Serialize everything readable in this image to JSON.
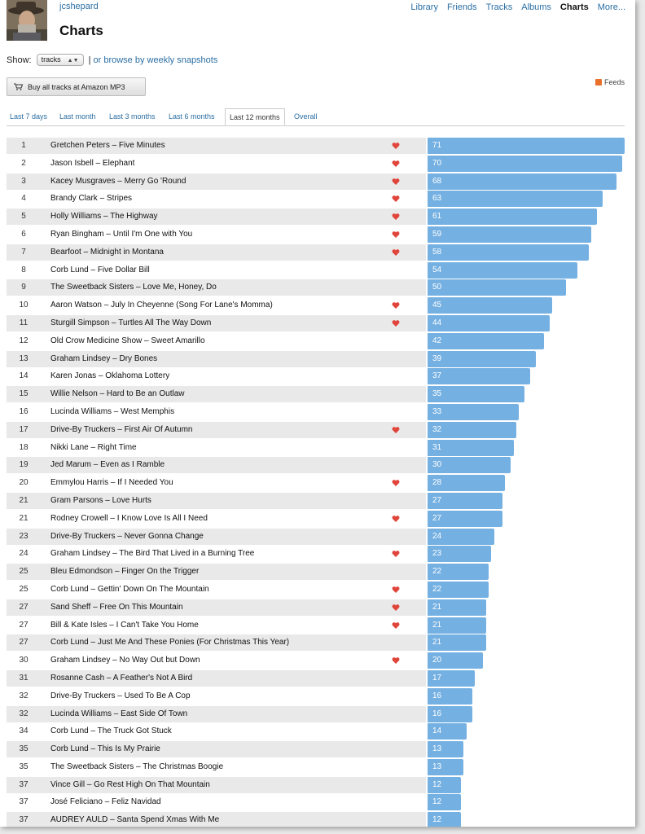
{
  "header": {
    "username": "jcshepard",
    "title": "Charts",
    "nav": [
      "Library",
      "Friends",
      "Tracks",
      "Albums",
      "Charts",
      "More..."
    ],
    "active_nav": "Charts"
  },
  "controls": {
    "show_label": "Show:",
    "show_value": "tracks",
    "separator": "|",
    "browse_link": "or browse by weekly snapshots",
    "buy_button": "Buy all tracks at Amazon MP3",
    "feeds": "Feeds"
  },
  "tabs": [
    "Last 7 days",
    "Last month",
    "Last 3 months",
    "Last 6 months",
    "Last 12 months",
    "Overall"
  ],
  "active_tab": "Last 12 months",
  "colors": {
    "bar": "#74b0e2",
    "link": "#2a6ea3",
    "heart": "#e0443a",
    "row_stripe": "#e9e9e9"
  },
  "chart_data": {
    "type": "bar",
    "rows": [
      {
        "rank": "1",
        "track": "Gretchen Peters – Five Minutes",
        "loved": true,
        "plays": 71
      },
      {
        "rank": "2",
        "track": "Jason Isbell – Elephant",
        "loved": true,
        "plays": 70
      },
      {
        "rank": "3",
        "track": "Kacey Musgraves – Merry Go 'Round",
        "loved": true,
        "plays": 68
      },
      {
        "rank": "4",
        "track": "Brandy Clark – Stripes",
        "loved": true,
        "plays": 63
      },
      {
        "rank": "5",
        "track": "Holly Williams – The Highway",
        "loved": true,
        "plays": 61
      },
      {
        "rank": "6",
        "track": "Ryan Bingham – Until I'm One with You",
        "loved": true,
        "plays": 59
      },
      {
        "rank": "7",
        "track": "Bearfoot – Midnight in Montana",
        "loved": true,
        "plays": 58
      },
      {
        "rank": "8",
        "track": "Corb Lund – Five Dollar Bill",
        "loved": false,
        "plays": 54
      },
      {
        "rank": "9",
        "track": "The Sweetback Sisters – Love Me, Honey, Do",
        "loved": false,
        "plays": 50
      },
      {
        "rank": "10",
        "track": "Aaron Watson – July In Cheyenne (Song For Lane's Momma)",
        "loved": true,
        "plays": 45
      },
      {
        "rank": "11",
        "track": "Sturgill Simpson – Turtles All The Way Down",
        "loved": true,
        "plays": 44
      },
      {
        "rank": "12",
        "track": "Old Crow Medicine Show – Sweet Amarillo",
        "loved": false,
        "plays": 42
      },
      {
        "rank": "13",
        "track": "Graham Lindsey – Dry Bones",
        "loved": false,
        "plays": 39
      },
      {
        "rank": "14",
        "track": "Karen Jonas – Oklahoma Lottery",
        "loved": false,
        "plays": 37
      },
      {
        "rank": "15",
        "track": "Willie Nelson – Hard to Be an Outlaw",
        "loved": false,
        "plays": 35
      },
      {
        "rank": "16",
        "track": "Lucinda Williams – West Memphis",
        "loved": false,
        "plays": 33
      },
      {
        "rank": "17",
        "track": "Drive-By Truckers – First Air Of Autumn",
        "loved": true,
        "plays": 32
      },
      {
        "rank": "18",
        "track": "Nikki Lane – Right Time",
        "loved": false,
        "plays": 31
      },
      {
        "rank": "19",
        "track": "Jed Marum – Even as I Ramble",
        "loved": false,
        "plays": 30
      },
      {
        "rank": "20",
        "track": "Emmylou Harris – If I Needed You",
        "loved": true,
        "plays": 28
      },
      {
        "rank": "21",
        "track": "Gram Parsons – Love Hurts",
        "loved": false,
        "plays": 27
      },
      {
        "rank": "21",
        "track": "Rodney Crowell – I Know Love Is All I Need",
        "loved": true,
        "plays": 27
      },
      {
        "rank": "23",
        "track": "Drive-By Truckers – Never Gonna Change",
        "loved": false,
        "plays": 24
      },
      {
        "rank": "24",
        "track": "Graham Lindsey – The Bird That Lived in a Burning Tree",
        "loved": true,
        "plays": 23
      },
      {
        "rank": "25",
        "track": "Bleu Edmondson – Finger On the Trigger",
        "loved": false,
        "plays": 22
      },
      {
        "rank": "25",
        "track": "Corb Lund – Gettin' Down On The Mountain",
        "loved": true,
        "plays": 22
      },
      {
        "rank": "27",
        "track": "Sand Sheff – Free On This Mountain",
        "loved": true,
        "plays": 21
      },
      {
        "rank": "27",
        "track": "Bill & Kate Isles – I Can't Take You Home",
        "loved": true,
        "plays": 21
      },
      {
        "rank": "27",
        "track": "Corb Lund – Just Me And These Ponies (For Christmas This Year)",
        "loved": false,
        "plays": 21
      },
      {
        "rank": "30",
        "track": "Graham Lindsey – No Way Out but Down",
        "loved": true,
        "plays": 20
      },
      {
        "rank": "31",
        "track": "Rosanne Cash – A Feather's Not A Bird",
        "loved": false,
        "plays": 17
      },
      {
        "rank": "32",
        "track": "Drive-By Truckers – Used To Be A Cop",
        "loved": false,
        "plays": 16
      },
      {
        "rank": "32",
        "track": "Lucinda Williams – East Side Of Town",
        "loved": false,
        "plays": 16
      },
      {
        "rank": "34",
        "track": "Corb Lund – The Truck Got Stuck",
        "loved": false,
        "plays": 14
      },
      {
        "rank": "35",
        "track": "Corb Lund – This Is My Prairie",
        "loved": false,
        "plays": 13
      },
      {
        "rank": "35",
        "track": "The Sweetback Sisters – The Christmas Boogie",
        "loved": false,
        "plays": 13
      },
      {
        "rank": "37",
        "track": "Vince Gill – Go Rest High On That Mountain",
        "loved": false,
        "plays": 12
      },
      {
        "rank": "37",
        "track": "José Feliciano – Feliz Navidad",
        "loved": false,
        "plays": 12
      },
      {
        "rank": "37",
        "track": "AUDREY AULD – Santa Spend Xmas With Me",
        "loved": false,
        "plays": 12
      }
    ]
  }
}
